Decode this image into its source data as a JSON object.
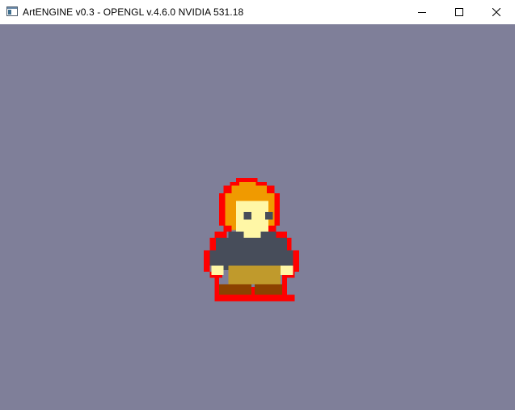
{
  "window": {
    "title": "ArtENGINE v0.3 - OPENGL v.4.6.0 NVIDIA 531.18",
    "controls": {
      "minimize_icon": "minimize-icon",
      "maximize_icon": "maximize-icon",
      "close_icon": "close-icon"
    }
  },
  "viewport": {
    "background_color": "#7f7f99"
  },
  "sprite": {
    "icon": "pixel-character-sprite",
    "colors": {
      "outline": "#ff0000",
      "hair": "#f09a00",
      "skin": "#fff7a6",
      "eyes": "#474d5a",
      "shirt": "#474d5a",
      "pants": "#c09a2c",
      "shoes": "#8c4200"
    }
  }
}
